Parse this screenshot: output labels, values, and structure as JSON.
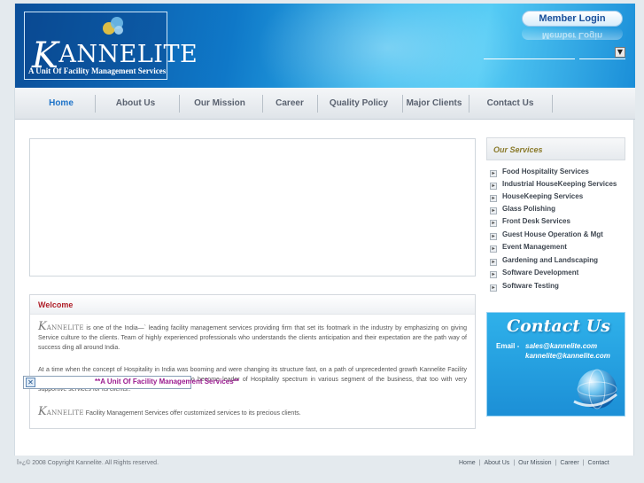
{
  "header": {
    "logo_name_initial": "K",
    "logo_name_rest": "ANNELITE",
    "logo_tagline": "A Unit Of Facility Management Services",
    "member_login": "Member Login",
    "member_login_reflection": "Member Login"
  },
  "nav": {
    "items": [
      {
        "label": "Home"
      },
      {
        "label": "About Us"
      },
      {
        "label": "Our Mission"
      },
      {
        "label": "Career"
      },
      {
        "label": "Quality Policy"
      },
      {
        "label": "Major Clients"
      },
      {
        "label": "Contact Us"
      }
    ]
  },
  "welcome": {
    "title": "Welcome",
    "brand_initial": "K",
    "brand_rest": "ANNELITE",
    "para1": "is one of the India—` leading facility management services providing firm that set its footmark in the industry by emphasizing on giving Service culture to the clients. Team of highly experienced professionals who understands the clients anticipation and their expectation are the path way of success ding all around India.",
    "para2": "At a time when the concept of Hospitality in India was booming and were changing its structure fast, on a path of unprecedented growth Kannelite Facility Management Services pioneered with the ambience to become leader of Hospitality spectrum in various segment of the business, that too with very supportive services for its clients..",
    "para3": "Facility Management Services offer customized services to its precious clients."
  },
  "popup": {
    "close_glyph": "✕",
    "text": "**A Unit Of Facility Management Services**"
  },
  "services": {
    "title": "Our Services",
    "items": [
      "Food Hospitality Services",
      "Industrial HouseKeeping Services",
      "HouseKeeping Services",
      "Glass Polishing",
      "Front Desk Services",
      "Guest House Operation & Mgt",
      "Event Management",
      "Gardening and Landscaping",
      "Software Development",
      "Software Testing"
    ]
  },
  "contact": {
    "title": "Contact Us",
    "label": "Email -",
    "email1": "sales@kannelite.com",
    "email2": "kannelite@kannelite.com"
  },
  "footer": {
    "copyright": "Ï»¿© 2008 Copyright Kannelite. All Rights reserved.",
    "links": [
      "Home",
      "About Us",
      "Our Mission",
      "Career",
      "Contact"
    ],
    "separator": "|"
  },
  "colors": {
    "header_blue": "#0f78c8",
    "active_nav": "#1e73c8",
    "welcome_red": "#b0202a",
    "services_gold": "#8a7a2a",
    "popup_purple": "#9b1a8f"
  },
  "icons": [
    "logo-bubbles-icon",
    "dropdown-arrow-icon",
    "bullet-arrow-icon",
    "close-icon",
    "globe-icon"
  ]
}
